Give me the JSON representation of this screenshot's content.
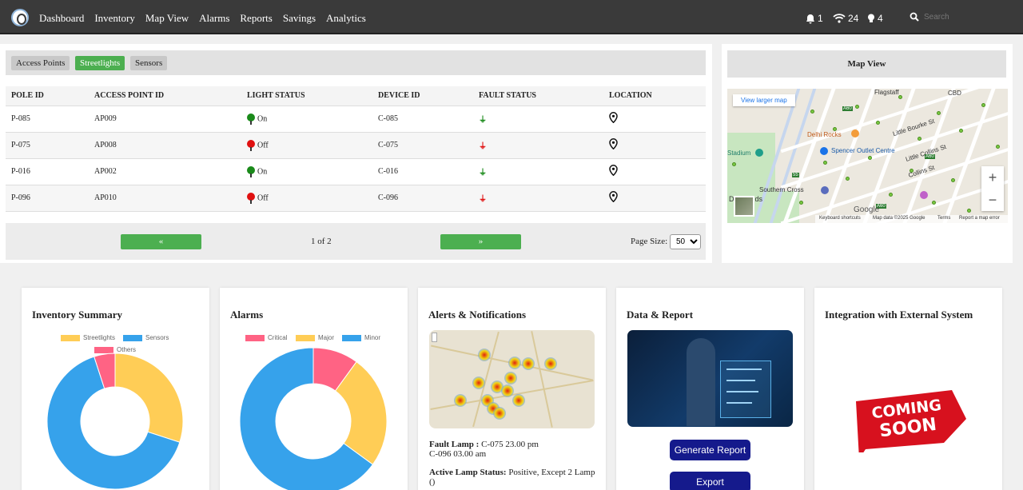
{
  "nav": {
    "items": [
      "Dashboard",
      "Inventory",
      "Map View",
      "Alarms",
      "Reports",
      "Savings",
      "Analytics"
    ],
    "bell_count": "1",
    "wifi_count": "24",
    "bulb_count": "4",
    "search_placeholder": "Search"
  },
  "table": {
    "tabs": [
      "Access Points",
      "Streetlights",
      "Sensors"
    ],
    "active_tab": "Streetlights",
    "columns": [
      "POLE ID",
      "ACCESS POINT ID",
      "LIGHT STATUS",
      "DEVICE ID",
      "FAULT STATUS",
      "LOCATION"
    ],
    "rows": [
      {
        "pole_id": "P-085",
        "ap_id": "AP009",
        "light_status": "On",
        "device_id": "C-085"
      },
      {
        "pole_id": "P-075",
        "ap_id": "AP008",
        "light_status": "Off",
        "device_id": "C-075"
      },
      {
        "pole_id": "P-016",
        "ap_id": "AP002",
        "light_status": "On",
        "device_id": "C-016"
      },
      {
        "pole_id": "P-096",
        "ap_id": "AP010",
        "light_status": "Off",
        "device_id": "C-096"
      }
    ],
    "pager": {
      "prev": "«",
      "next": "»",
      "info": "1 of 2",
      "page_size_label": "Page Size:",
      "page_size": "50"
    }
  },
  "map": {
    "title": "Map View",
    "larger_link": "View larger map",
    "labels": [
      "Flagstaff",
      "CBD",
      "Delhi Rocks",
      "Spencer Outlet Centre",
      "Little Bourke St",
      "Little Collins St",
      "Collins St",
      "Stadium",
      "Southern Cross",
      "Docklands",
      "A60",
      "A60",
      "A60",
      "55"
    ],
    "attribution": [
      "Keyboard shortcuts",
      "Map data ©2025 Google",
      "Terms",
      "Report a map error"
    ],
    "google": "Google",
    "zoom_in": "+",
    "zoom_out": "−"
  },
  "cards": {
    "inventory": {
      "title": "Inventory Summary",
      "legend": [
        "Streetlights",
        "Sensors",
        "Others"
      ]
    },
    "alarms": {
      "title": "Alarms",
      "legend": [
        "Critical",
        "Major",
        "Minor"
      ]
    },
    "alerts": {
      "title": "Alerts & Notifications",
      "fault_label": "Fault Lamp :",
      "fault_line1": "C-075 23.00 pm",
      "fault_line2": "C-096 03.00 am",
      "active_label": "Active Lamp Status:",
      "active_value": "Positive, Except 2 Lamp",
      "active_tail": "()"
    },
    "report": {
      "title": "Data & Report",
      "generate": "Generate Report",
      "export": "Export"
    },
    "integration": {
      "title": "Integration with External System",
      "coming": "COMING SOON"
    }
  },
  "colors": {
    "green": "#4caf50",
    "red": "#e01010",
    "yellow": "#ffcd56",
    "blue": "#36a2eb",
    "pink": "#ff6384",
    "navy": "#151a8c"
  },
  "chart_data": [
    {
      "type": "pie",
      "title": "Inventory Summary",
      "categories": [
        "Streetlights",
        "Sensors",
        "Others"
      ],
      "values": [
        30,
        65,
        5
      ],
      "donut": true,
      "colors": [
        "#ffcd56",
        "#36a2eb",
        "#ff6384"
      ],
      "legend": "top"
    },
    {
      "type": "pie",
      "title": "Alarms",
      "categories": [
        "Critical",
        "Major",
        "Minor"
      ],
      "values": [
        10,
        25,
        65
      ],
      "donut": true,
      "colors": [
        "#ff6384",
        "#ffcd56",
        "#36a2eb"
      ],
      "legend": "top"
    }
  ]
}
